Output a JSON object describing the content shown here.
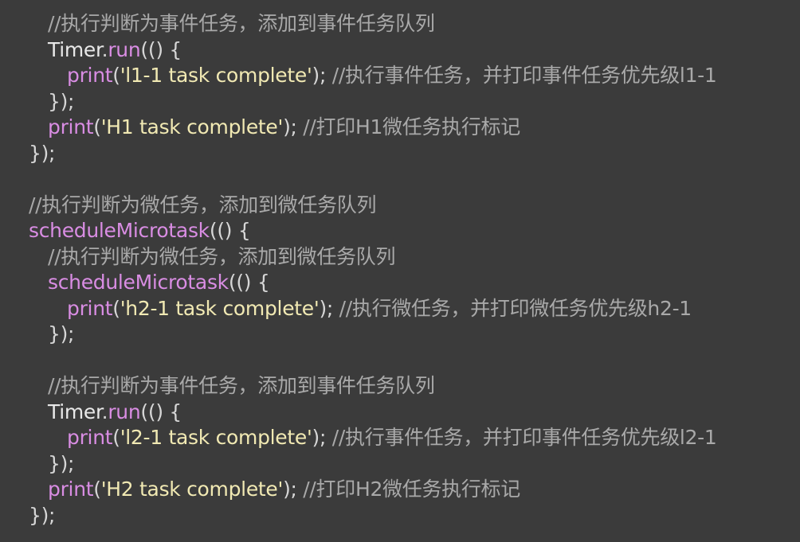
{
  "colors": {
    "background": "#3b3b3b",
    "comment": "#a9a9a9",
    "plain": "#d6d6d6",
    "class_name": "#e8e8e8",
    "function": "#d98de3",
    "string": "#f1e9b3"
  },
  "code": {
    "lines": [
      {
        "indent": 1,
        "tokens": [
          {
            "t": "comment",
            "v": "//执行判断为事件任务，添加到事件任务队列"
          }
        ]
      },
      {
        "indent": 1,
        "tokens": [
          {
            "t": "class",
            "v": "Timer"
          },
          {
            "t": "punct",
            "v": "."
          },
          {
            "t": "func",
            "v": "run"
          },
          {
            "t": "punct",
            "v": "(() {"
          }
        ]
      },
      {
        "indent": 2,
        "tokens": [
          {
            "t": "func",
            "v": "print"
          },
          {
            "t": "punct",
            "v": "("
          },
          {
            "t": "string",
            "v": "'l1-1 task complete'"
          },
          {
            "t": "punct",
            "v": "); "
          },
          {
            "t": "comment",
            "v": "//执行事件任务，并打印事件任务优先级l1-1"
          }
        ]
      },
      {
        "indent": 1,
        "tokens": [
          {
            "t": "punct",
            "v": "});"
          }
        ]
      },
      {
        "indent": 1,
        "tokens": [
          {
            "t": "func",
            "v": "print"
          },
          {
            "t": "punct",
            "v": "("
          },
          {
            "t": "string",
            "v": "'H1 task complete'"
          },
          {
            "t": "punct",
            "v": "); "
          },
          {
            "t": "comment",
            "v": "//打印H1微任务执行标记"
          }
        ]
      },
      {
        "indent": 0,
        "tokens": [
          {
            "t": "punct",
            "v": "});"
          }
        ]
      },
      {
        "indent": 0,
        "tokens": []
      },
      {
        "indent": 0,
        "tokens": [
          {
            "t": "comment",
            "v": "//执行判断为微任务，添加到微任务队列"
          }
        ]
      },
      {
        "indent": 0,
        "tokens": [
          {
            "t": "func",
            "v": "scheduleMicrotask"
          },
          {
            "t": "punct",
            "v": "(() {"
          }
        ]
      },
      {
        "indent": 1,
        "tokens": [
          {
            "t": "comment",
            "v": "//执行判断为微任务，添加到微任务队列"
          }
        ]
      },
      {
        "indent": 1,
        "tokens": [
          {
            "t": "func",
            "v": "scheduleMicrotask"
          },
          {
            "t": "punct",
            "v": "(() {"
          }
        ]
      },
      {
        "indent": 2,
        "tokens": [
          {
            "t": "func",
            "v": "print"
          },
          {
            "t": "punct",
            "v": "("
          },
          {
            "t": "string",
            "v": "'h2-1 task complete'"
          },
          {
            "t": "punct",
            "v": "); "
          },
          {
            "t": "comment",
            "v": "//执行微任务，并打印微任务优先级h2-1"
          }
        ]
      },
      {
        "indent": 1,
        "tokens": [
          {
            "t": "punct",
            "v": "});"
          }
        ]
      },
      {
        "indent": 0,
        "tokens": []
      },
      {
        "indent": 1,
        "tokens": [
          {
            "t": "comment",
            "v": "//执行判断为事件任务，添加到事件任务队列"
          }
        ]
      },
      {
        "indent": 1,
        "tokens": [
          {
            "t": "class",
            "v": "Timer"
          },
          {
            "t": "punct",
            "v": "."
          },
          {
            "t": "func",
            "v": "run"
          },
          {
            "t": "punct",
            "v": "(() {"
          }
        ]
      },
      {
        "indent": 2,
        "tokens": [
          {
            "t": "func",
            "v": "print"
          },
          {
            "t": "punct",
            "v": "("
          },
          {
            "t": "string",
            "v": "'l2-1 task complete'"
          },
          {
            "t": "punct",
            "v": "); "
          },
          {
            "t": "comment",
            "v": "//执行事件任务，并打印事件任务优先级l2-1"
          }
        ]
      },
      {
        "indent": 1,
        "tokens": [
          {
            "t": "punct",
            "v": "});"
          }
        ]
      },
      {
        "indent": 1,
        "tokens": [
          {
            "t": "func",
            "v": "print"
          },
          {
            "t": "punct",
            "v": "("
          },
          {
            "t": "string",
            "v": "'H2 task complete'"
          },
          {
            "t": "punct",
            "v": "); "
          },
          {
            "t": "comment",
            "v": "//打印H2微任务执行标记"
          }
        ]
      },
      {
        "indent": 0,
        "tokens": [
          {
            "t": "punct",
            "v": "});"
          }
        ]
      }
    ]
  }
}
